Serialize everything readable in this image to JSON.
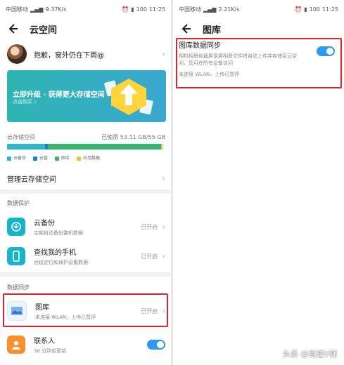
{
  "left": {
    "status": {
      "carrier": "中国移动",
      "speed": "9.37K/s",
      "battery": "100",
      "time": "11:25"
    },
    "title": "云空间",
    "profile_name": "抱歉，窗外仍在下雨@",
    "banner": {
      "title": "立即升级 · 获得更大存储空间",
      "subtitle": "点击购买 〉"
    },
    "storage": {
      "label": "云存储空间",
      "used": "已使用 53.11 GB/55 GB"
    },
    "legend": [
      {
        "label": "云备份",
        "color": "#2bb8c8"
      },
      {
        "label": "云盘",
        "color": "#1b7fd6"
      },
      {
        "label": "图库",
        "color": "#35b66a"
      },
      {
        "label": "应用数据",
        "color": "#f1c232"
      }
    ],
    "manage": "管理云存储空间",
    "sections": {
      "protect": "数据保护",
      "sync": "数据同步"
    },
    "items": [
      {
        "title": "云备份",
        "desc": "定期自动备份整机数据",
        "status": "已开启"
      },
      {
        "title": "查找我的手机",
        "desc": "远程定位和保护设备数据",
        "status": "已开启"
      },
      {
        "title": "图库",
        "desc": "未连接 WLAN，上传已暂停",
        "status": "已开启"
      },
      {
        "title": "联系人",
        "desc": "30 分钟前更新",
        "status": ""
      }
    ]
  },
  "right": {
    "status": {
      "carrier": "中国移动",
      "speed": "2.21K/s",
      "battery": "100",
      "time": "11:25"
    },
    "title": "图库",
    "sync": {
      "title": "图库数据同步",
      "desc": "相机相册和截屏录屏相册文件将自动上传并存储至云空间，您可在所有设备访问",
      "note": "未连接 WLAN，上传已暂停"
    }
  },
  "watermark": "头条 @青建V视",
  "colors": {
    "accent": "#2d9af0",
    "highlight": "#d9262c"
  }
}
